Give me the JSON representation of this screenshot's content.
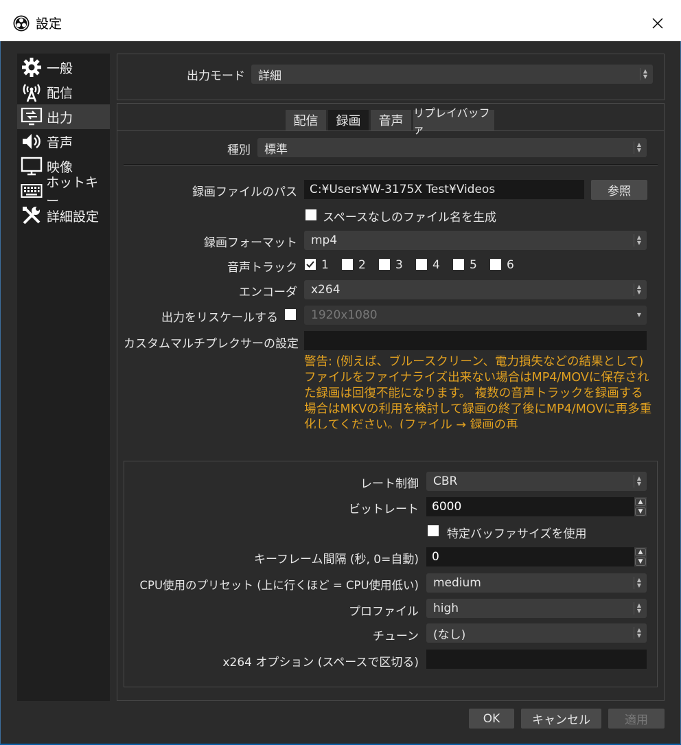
{
  "window": {
    "title": "設定"
  },
  "sidebar": {
    "items": [
      {
        "label": "一般",
        "icon": "gear-icon"
      },
      {
        "label": "配信",
        "icon": "broadcast-icon"
      },
      {
        "label": "出力",
        "icon": "output-icon"
      },
      {
        "label": "音声",
        "icon": "speaker-icon"
      },
      {
        "label": "映像",
        "icon": "monitor-icon"
      },
      {
        "label": "ホットキー",
        "icon": "keyboard-icon"
      },
      {
        "label": "詳細設定",
        "icon": "tools-icon"
      }
    ],
    "active": "出力"
  },
  "output_mode": {
    "label": "出力モード",
    "value": "詳細"
  },
  "tabs": [
    {
      "label": "配信"
    },
    {
      "label": "録画"
    },
    {
      "label": "音声"
    },
    {
      "label": "リプレイバッファ"
    }
  ],
  "active_tab": "録画",
  "recording": {
    "type": {
      "label": "種別",
      "value": "標準"
    },
    "path": {
      "label": "録画ファイルのパス",
      "value": "C:¥Users¥W-3175X Test¥Videos",
      "browse_label": "参照"
    },
    "no_space": {
      "label": "スペースなしのファイル名を生成",
      "checked": false
    },
    "format": {
      "label": "録画フォーマット",
      "value": "mp4"
    },
    "audio_track": {
      "label": "音声トラック",
      "tracks": [
        "1",
        "2",
        "3",
        "4",
        "5",
        "6"
      ],
      "checked": [
        true,
        false,
        false,
        false,
        false,
        false
      ]
    },
    "encoder": {
      "label": "エンコーダ",
      "value": "x264"
    },
    "rescale": {
      "label": "出力をリスケールする",
      "checked": false,
      "value": "1920x1080"
    },
    "muxer": {
      "label": "カスタムマルチプレクサーの設定",
      "value": ""
    },
    "warning": "警告: (例えば、ブルースクリーン、電力損失などの結果として)ファイルをファイナライズ出来ない場合はMP4/MOVに保存された録画は回復不能になります。 複数の音声トラックを録画する場合はMKVの利用を検討して録画の終了後にMP4/MOVに再多重化してください。(ファイル → 録画の再"
  },
  "encoder_settings": {
    "rate_control": {
      "label": "レート制御",
      "value": "CBR"
    },
    "bitrate": {
      "label": "ビットレート",
      "value": "6000"
    },
    "custom_buffer": {
      "label": "特定バッファサイズを使用",
      "checked": false
    },
    "keyframe": {
      "label": "キーフレーム間隔 (秒, 0=自動)",
      "value": "0"
    },
    "preset": {
      "label": "CPU使用のプリセット (上に行くほど = CPU使用低い)",
      "value": "medium"
    },
    "profile": {
      "label": "プロファイル",
      "value": "high"
    },
    "tune": {
      "label": "チューン",
      "value": "(なし)"
    },
    "options": {
      "label": "x264 オプション (スペースで区切る)",
      "value": ""
    }
  },
  "footer": {
    "ok": "OK",
    "cancel": "キャンセル",
    "apply": "適用"
  }
}
